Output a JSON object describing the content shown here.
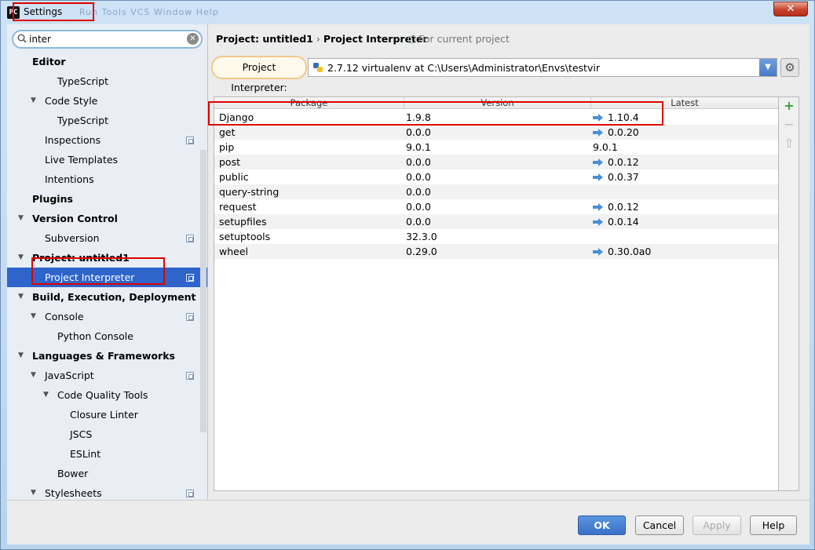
{
  "window": {
    "title": "Settings",
    "ghost_menu": "Run  Tools  VCS  Window  Help",
    "close_label": "✕"
  },
  "search": {
    "value": "inter"
  },
  "tree": [
    {
      "label": "Editor",
      "level": 0,
      "bold": true,
      "arrow": ""
    },
    {
      "label": "TypeScript",
      "level": 2
    },
    {
      "label": "Code Style",
      "level": 1,
      "arrow": "▼"
    },
    {
      "label": "TypeScript",
      "level": 2
    },
    {
      "label": "Inspections",
      "level": 1,
      "copy": true
    },
    {
      "label": "Live Templates",
      "level": 1
    },
    {
      "label": "Intentions",
      "level": 1
    },
    {
      "label": "Plugins",
      "level": 0,
      "bold": true
    },
    {
      "label": "Version Control",
      "level": 0,
      "bold": true,
      "arrow": "▼"
    },
    {
      "label": "Subversion",
      "level": 1,
      "copy": true
    },
    {
      "label": "Project: untitled1",
      "level": 0,
      "bold": true,
      "arrow": "▼"
    },
    {
      "label": "Project Interpreter",
      "level": 1,
      "copy": true,
      "selected": true
    },
    {
      "label": "Build, Execution, Deployment",
      "level": 0,
      "bold": true,
      "arrow": "▼"
    },
    {
      "label": "Console",
      "level": 1,
      "arrow": "▼",
      "copy": true
    },
    {
      "label": "Python Console",
      "level": 2
    },
    {
      "label": "Languages & Frameworks",
      "level": 0,
      "bold": true,
      "arrow": "▼"
    },
    {
      "label": "JavaScript",
      "level": 1,
      "arrow": "▼",
      "copy": true
    },
    {
      "label": "Code Quality Tools",
      "level": 2,
      "arrow": "▼"
    },
    {
      "label": "Closure Linter",
      "level": 3
    },
    {
      "label": "JSCS",
      "level": 3
    },
    {
      "label": "ESLint",
      "level": 3
    },
    {
      "label": "Bower",
      "level": 2
    },
    {
      "label": "Stylesheets",
      "level": 1,
      "arrow": "▼",
      "copy": true
    }
  ],
  "breadcrumb": {
    "project": "Project: untitled1",
    "separator": "›",
    "page": "Project Interpreter",
    "note": "For current project"
  },
  "interpreter": {
    "label": "Project Interpreter:",
    "value": "2.7.12 virtualenv at C:\\Users\\Administrator\\Envs\\testvir"
  },
  "table": {
    "headers": [
      "Package",
      "Version",
      "Latest"
    ],
    "rows": [
      {
        "package": "Django",
        "version": "1.9.8",
        "latest": "1.10.4",
        "upgrade": true
      },
      {
        "package": "get",
        "version": "0.0.0",
        "latest": "0.0.20",
        "upgrade": true
      },
      {
        "package": "pip",
        "version": "9.0.1",
        "latest": "9.0.1",
        "upgrade": false
      },
      {
        "package": "post",
        "version": "0.0.0",
        "latest": "0.0.12",
        "upgrade": true
      },
      {
        "package": "public",
        "version": "0.0.0",
        "latest": "0.0.37",
        "upgrade": true
      },
      {
        "package": "query-string",
        "version": "0.0.0",
        "latest": "",
        "upgrade": false
      },
      {
        "package": "request",
        "version": "0.0.0",
        "latest": "0.0.12",
        "upgrade": true
      },
      {
        "package": "setupfiles",
        "version": "0.0.0",
        "latest": "0.0.14",
        "upgrade": true
      },
      {
        "package": "setuptools",
        "version": "32.3.0",
        "latest": "",
        "upgrade": false
      },
      {
        "package": "wheel",
        "version": "0.29.0",
        "latest": "0.30.0a0",
        "upgrade": true
      }
    ]
  },
  "side_tools": {
    "add": "+",
    "remove": "−",
    "upgrade": "⇧"
  },
  "buttons": {
    "ok": "OK",
    "cancel": "Cancel",
    "apply": "Apply",
    "help": "Help"
  },
  "colors": {
    "selection": "#2f65ca",
    "annotation": "#e00000",
    "upgrade_arrow": "#4a8fd6"
  }
}
